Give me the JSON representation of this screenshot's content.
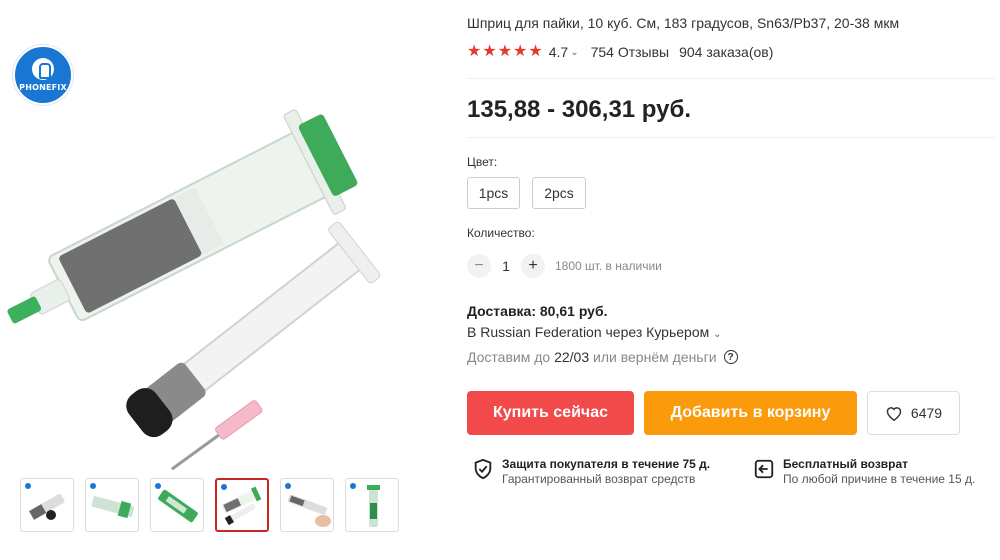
{
  "store": {
    "brand": "PHONEFIX"
  },
  "product": {
    "title": "Шприц для пайки, 10 куб. См, 183 градусов, Sn63/Pb37, 20-38 мкм",
    "rating": {
      "stars": 5,
      "value": "4.7",
      "reviews": "754 Отзывы",
      "orders": "904 заказа(ов)"
    },
    "price": "135,88 - 306,31 руб.",
    "color_label": "Цвет:",
    "variants": [
      "1pcs",
      "2pcs"
    ],
    "quantity_label": "Количество:",
    "quantity": "1",
    "minus": "−",
    "plus": "+",
    "stock": "1800 шт. в наличии"
  },
  "shipping": {
    "title": "Доставка: 80,61 руб.",
    "destination": "В Russian Federation через Курьером",
    "date_prefix": "Доставим до",
    "date": "22/03",
    "date_suffix": "или вернём деньги",
    "help": "?"
  },
  "actions": {
    "buy_now": "Купить сейчас",
    "add_to_cart": "Добавить в корзину",
    "wishlist_count": "6479"
  },
  "guarantees": [
    {
      "title": "Защита покупателя в течение 75 д.",
      "subtitle": "Гарантированный возврат средств"
    },
    {
      "title": "Бесплатный возврат",
      "subtitle": "По любой причине в течение 15 д."
    }
  ],
  "gallery": {
    "thumb_count": 6,
    "active_index": 3
  },
  "colors": {
    "star": "#e53935",
    "buy": "#f24a4a",
    "cart": "#fb9a0a",
    "active_thumb": "#c62828",
    "logo": "#1976d2"
  }
}
